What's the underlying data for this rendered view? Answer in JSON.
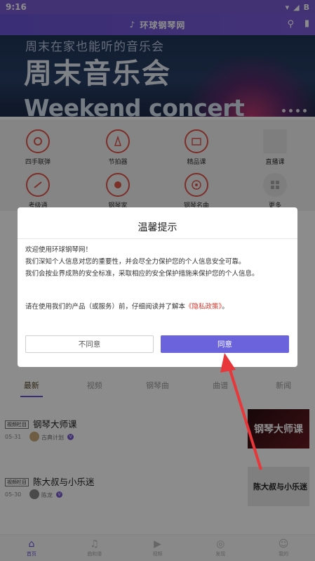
{
  "status": {
    "time": "9:16",
    "battery_label": "B"
  },
  "header": {
    "app_name": "环球钢琴网",
    "logo_icon": "piano-note-icon",
    "search_icon": "search-icon",
    "chart_icon": "bar-chart-icon"
  },
  "banner": {
    "subtitle": "周末在家也能听的音乐会",
    "title": "周末音乐会",
    "title_en": "Weekend concert",
    "dot_count": 4
  },
  "grid": {
    "row1": [
      {
        "label": "四手联弹",
        "icon": "four-hands-icon",
        "color": "#e2574c"
      },
      {
        "label": "节拍器",
        "icon": "metronome-icon",
        "color": "#e2574c"
      },
      {
        "label": "精品课",
        "icon": "premium-course-icon",
        "color": "#e2574c"
      },
      {
        "label": "直播课",
        "icon": "live-course-icon",
        "color": "#d8d8d8"
      }
    ],
    "row2": [
      {
        "label": "考级通",
        "icon": "exam-icon",
        "color": "#e2574c"
      },
      {
        "label": "钢琴家",
        "icon": "pianist-icon",
        "color": "#e2574c"
      },
      {
        "label": "钢琴名曲",
        "icon": "vinyl-icon",
        "color": "#e2574c"
      },
      {
        "label": "更多",
        "icon": "more-grid-icon",
        "color": "#aaaaaa"
      }
    ]
  },
  "dialog": {
    "title": "温馨提示",
    "line1": "欢迎使用环球钢琴网！",
    "line2": "我们深知个人信息对您的重要性，并会尽全力保护您的个人信息安全可靠。",
    "line3": "我们会按业界成熟的安全标准，采取相应的安全保护措施来保护您的个人信息。",
    "policy_prefix": "请在使用我们的产品（或服务）前，仔细阅读并了解本",
    "policy_link": "《隐私政策》",
    "policy_suffix": "。",
    "deny_label": "不同意",
    "agree_label": "同意"
  },
  "tabs": [
    "最新",
    "视频",
    "钢琴曲",
    "曲谱",
    "新闻"
  ],
  "list": [
    {
      "badge": "视频栏目",
      "title": "钢琴大师课",
      "date": "05-31",
      "author": "古典计划",
      "thumb_text": "钢琴大师课"
    },
    {
      "badge": "视频栏目",
      "title": "陈大叔与小乐迷",
      "date": "05-30",
      "author": "陈龙",
      "thumb_text": "陈大叔与小乐迷"
    }
  ],
  "bottom_nav": [
    {
      "label": "首页",
      "icon": "home-icon",
      "active": true
    },
    {
      "label": "曲和谱",
      "icon": "sheet-music-icon",
      "active": false
    },
    {
      "label": "视频",
      "icon": "video-icon",
      "active": false
    },
    {
      "label": "发现",
      "icon": "compass-icon",
      "active": false
    },
    {
      "label": "我的",
      "icon": "user-icon",
      "active": false
    }
  ],
  "colors": {
    "accent": "#6a55d8",
    "agree_button": "#6a63dc",
    "policy_link": "#d9372c",
    "annotation_arrow": "#e8373a"
  }
}
